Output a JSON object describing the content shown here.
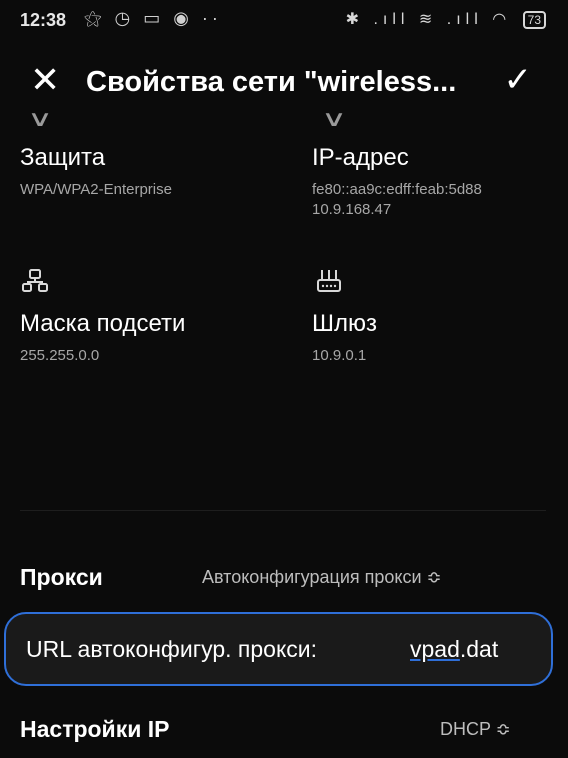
{
  "status_bar": {
    "time": "12:38",
    "notif_icons": "⚝ ◷ ▭ ◉ ··",
    "right_icons": "✱ .ıll ≋ .ıll ◠",
    "battery": "73"
  },
  "header": {
    "title": "Свойства сети \"wireless...",
    "close_icon": "close-icon",
    "confirm_icon": "check-icon"
  },
  "info": {
    "security": {
      "label": "Защита",
      "value": "WPA/WPA2-Enterprise"
    },
    "ip": {
      "label": "IP-адрес",
      "value_line1": "fe80::aa9c:edff:feab:5d88",
      "value_line2": "10.9.168.47"
    },
    "mask": {
      "label": "Маска подсети",
      "value": "255.255.0.0"
    },
    "gateway": {
      "label": "Шлюз",
      "value": "10.9.0.1"
    }
  },
  "proxy": {
    "label": "Прокси",
    "value": "Автоконфигурация прокси ≎"
  },
  "proxy_url": {
    "label": "URL автоконфигур. прокси:",
    "value_underlined": "vpad",
    "value_rest": ".dat"
  },
  "ip_settings": {
    "label": "Настройки IP",
    "value": "DHCP ≎"
  },
  "colors": {
    "background": "#0b0b0b",
    "accent": "#2f6fd8",
    "secondary_text": "#a7a7a7"
  }
}
